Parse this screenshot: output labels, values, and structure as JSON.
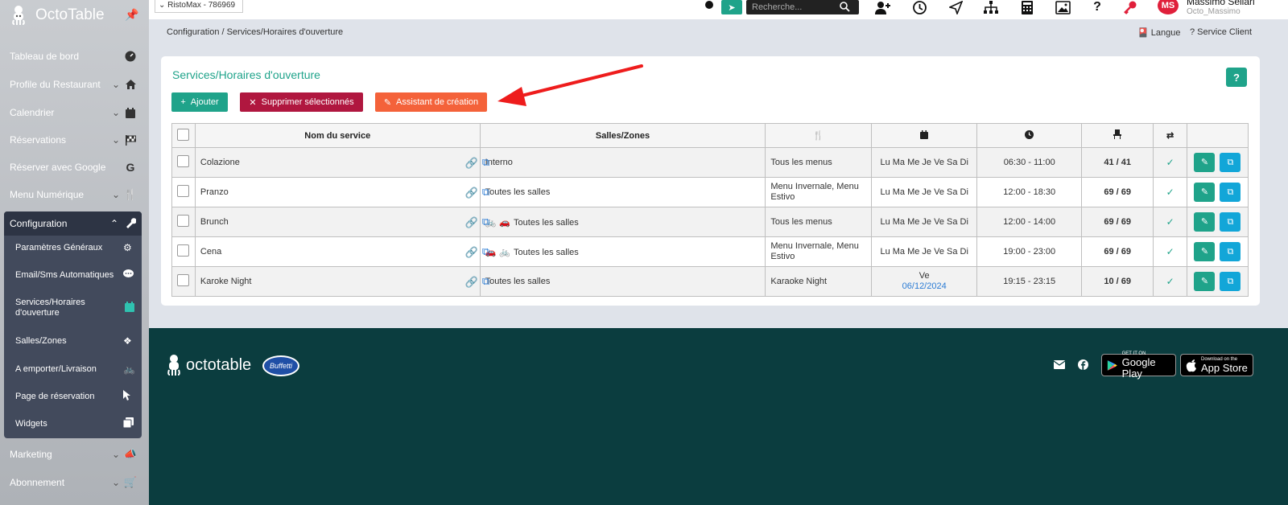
{
  "sidebar": {
    "brand": "OctoTable",
    "items": [
      {
        "label": "Tableau de bord"
      },
      {
        "label": "Profile du Restaurant"
      },
      {
        "label": "Calendrier"
      },
      {
        "label": "Réservations"
      },
      {
        "label": "Réserver avec Google"
      },
      {
        "label": "Menu Numérique"
      }
    ],
    "config": {
      "label": "Configuration",
      "subitems": [
        {
          "label": "Paramètres Généraux"
        },
        {
          "label": "Email/Sms Automatiques"
        },
        {
          "label": "Services/Horaires d'ouverture"
        },
        {
          "label": "Salles/Zones"
        },
        {
          "label": "A emporter/Livraison"
        },
        {
          "label": "Page de réservation"
        },
        {
          "label": "Widgets"
        }
      ]
    },
    "bottom_items": [
      {
        "label": "Marketing"
      },
      {
        "label": "Abonnement"
      }
    ]
  },
  "topbar": {
    "restaurant": "RistoMax - 786969",
    "search_placeholder": "Recherche...",
    "avatar_initials": "MS",
    "user_name": "Massimo Sellari",
    "user_login": "Octo_Massimo"
  },
  "breadcrumb": "Configuration / Services/Horaires d'ouverture",
  "lang_label": "Langue",
  "service_client_label": "? Service Client",
  "page": {
    "title": "Services/Horaires d'ouverture",
    "help": "?",
    "btn_add": "Ajouter",
    "btn_delete": "Supprimer sélectionnés",
    "btn_wizard": "Assistant de création"
  },
  "table": {
    "headers": {
      "name": "Nom du service",
      "zones": "Salles/Zones"
    },
    "rows": [
      {
        "name": "Colazione",
        "zones": "Interno",
        "zone_icons": "",
        "menus": "Tous les menus",
        "days": "Lu Ma Me Je Ve Sa Di",
        "date": "",
        "time": "06:30 - 11:00",
        "capacity": "41 / 41"
      },
      {
        "name": "Pranzo",
        "zones": "Toutes les salles",
        "zone_icons": "",
        "menus": "Menu Invernale, Menu Estivo",
        "days": "Lu Ma Me Je Ve Sa Di",
        "date": "",
        "time": "12:00 - 18:30",
        "capacity": "69 / 69"
      },
      {
        "name": "Brunch",
        "zones": "Toutes les salles",
        "zone_icons": "bike car",
        "menus": "Tous les menus",
        "days": "Lu Ma Me Je Ve Sa Di",
        "date": "",
        "time": "12:00 - 14:00",
        "capacity": "69 / 69"
      },
      {
        "name": "Cena",
        "zones": "Toutes les salles",
        "zone_icons": "car bike",
        "menus": "Menu Invernale, Menu Estivo",
        "days": "Lu Ma Me Je Ve Sa Di",
        "date": "",
        "time": "19:00 - 23:00",
        "capacity": "69 / 69"
      },
      {
        "name": "Karoke Night",
        "zones": "Toutes les salles",
        "zone_icons": "",
        "menus": "Karaoke Night",
        "days": "Ve",
        "date": "06/12/2024",
        "time": "19:15 - 23:15",
        "capacity": "10 / 69"
      }
    ]
  },
  "footer": {
    "logo": "octotable",
    "partner": "Buffetti",
    "google_top": "GET IT ON",
    "google_main": "Google Play",
    "apple_top": "Download on the",
    "apple_main": "App Store"
  },
  "colors": {
    "accent": "#1fa38a",
    "danger": "#b0173f",
    "orange": "#f4623a",
    "footer": "#0b3d3f"
  }
}
